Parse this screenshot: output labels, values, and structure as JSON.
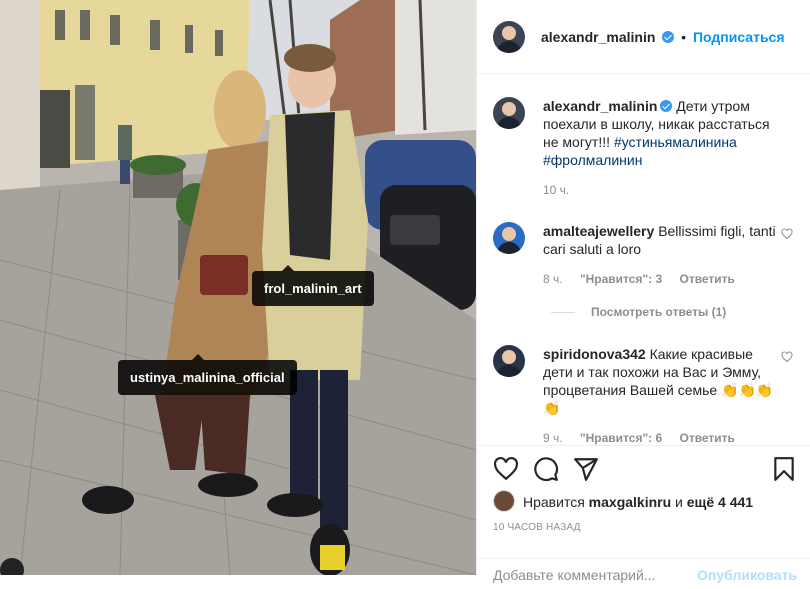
{
  "post": {
    "author": "alexandr_malinin",
    "follow_label": "Подписаться",
    "caption_prefix": "Дети утром поехали в школу, никак расстаться не могут!!! ",
    "hashtag1": "#устиньямалинина",
    "hashtag2": "#фролмалинин",
    "caption_time": "10 ч.",
    "photo_tags": [
      "frol_malinin_art",
      "ustinya_malinina_official"
    ]
  },
  "comments": [
    {
      "user": "amalteajewellery",
      "text": "Bellissimi figli, tanti cari saluti a loro",
      "time": "8 ч.",
      "likes": "\"Нравится\": 3",
      "reply": "Ответить",
      "view_replies": "Посмотреть ответы (1)"
    },
    {
      "user": "spiridonova342",
      "text": "Какие красивые дети и так похожи на Вас и Эмму, процветания Вашей семье 👏👏👏👏",
      "time": "9 ч.",
      "likes": "\"Нравится\": 6",
      "reply": "Ответить"
    }
  ],
  "footer": {
    "liked_by_prefix": "Нравится ",
    "liked_by_user": "maxgalkinru",
    "liked_by_suffix_pre": " и ",
    "liked_by_count": "ещё 4 441",
    "timestamp": "10 ЧАСОВ НАЗАД",
    "comment_placeholder": "Добавьте комментарий...",
    "publish_label": "Опубликовать"
  },
  "icons": [
    "heart-icon",
    "comment-icon",
    "share-icon",
    "bookmark-icon",
    "verified-icon"
  ],
  "colors": {
    "accent": "#0095f6",
    "link": "#00376b",
    "muted": "#8e8e8e",
    "tag_bg": "#000000"
  }
}
